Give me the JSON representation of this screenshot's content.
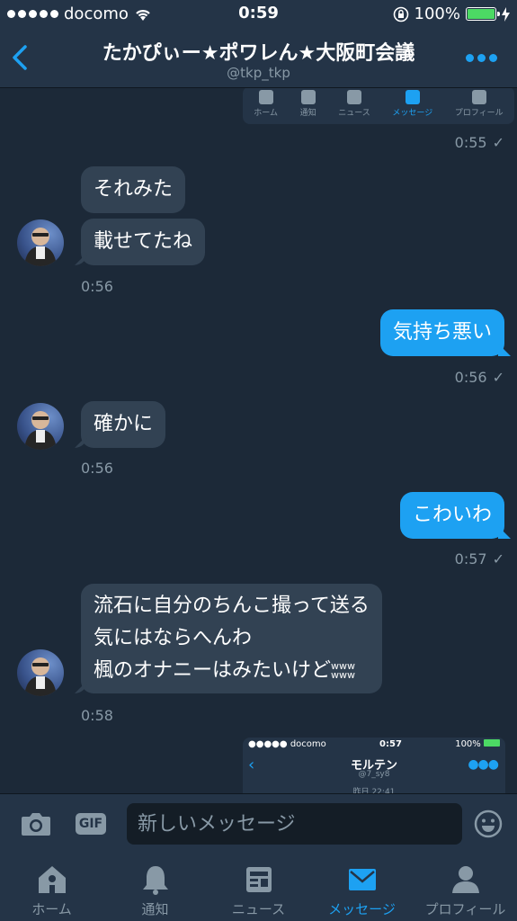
{
  "status_bar": {
    "carrier": "docomo",
    "time": "0:59",
    "battery": "100%",
    "battery_level": 1.0
  },
  "header": {
    "title": "たかぴぃー★ポワレん★大阪町会議",
    "handle": "@tkp_tkp"
  },
  "embedded_screenshot_top": {
    "tabs": [
      "ホーム",
      "通知",
      "ニュース",
      "メッセージ",
      "プロフィール"
    ],
    "active_tab": "メッセージ"
  },
  "messages": [
    {
      "id": "t1",
      "type": "stamp",
      "text": "0:55",
      "check": "✓"
    },
    {
      "id": "m1",
      "type": "in",
      "text": "それみた"
    },
    {
      "id": "m2",
      "type": "in",
      "text": "載せてたね"
    },
    {
      "id": "t2",
      "type": "stamp",
      "text": "0:56"
    },
    {
      "id": "m3",
      "type": "out",
      "text": "気持ち悪い"
    },
    {
      "id": "t3",
      "type": "stamp",
      "text": "0:56",
      "check": "✓"
    },
    {
      "id": "m4",
      "type": "in",
      "text": "確かに"
    },
    {
      "id": "t4",
      "type": "stamp",
      "text": "0:56"
    },
    {
      "id": "m5",
      "type": "out",
      "text": "こわいわ"
    },
    {
      "id": "t5",
      "type": "stamp",
      "text": "0:57",
      "check": "✓"
    },
    {
      "id": "m6",
      "type": "in",
      "lines": [
        "流石に自分のちんこ撮って送る",
        "気にはならへんわ",
        "楓のオナニーはみたいけど"
      ],
      "suffix_small": [
        "www",
        "www"
      ]
    },
    {
      "id": "t6",
      "type": "stamp",
      "text": "0:58"
    }
  ],
  "embedded_screenshot_bottom": {
    "carrier": "docomo",
    "time": "0:57",
    "battery": "100%",
    "title": "モルテン",
    "handle": "@7_sy8",
    "partial_text": "昨日 22:41"
  },
  "composer": {
    "gif_label": "GIF",
    "placeholder": "新しいメッセージ"
  },
  "tab_bar": {
    "tabs": [
      {
        "label": "ホーム",
        "icon": "home-icon"
      },
      {
        "label": "通知",
        "icon": "bell-icon"
      },
      {
        "label": "ニュース",
        "icon": "news-icon"
      },
      {
        "label": "メッセージ",
        "icon": "envelope-icon"
      },
      {
        "label": "プロフィール",
        "icon": "person-icon"
      }
    ],
    "active_tab": "メッセージ"
  },
  "colors": {
    "accent": "#1da1f2",
    "background": "#1c2938",
    "bar": "#243447",
    "incoming_bubble": "#324253",
    "muted_text": "#8899a6"
  }
}
